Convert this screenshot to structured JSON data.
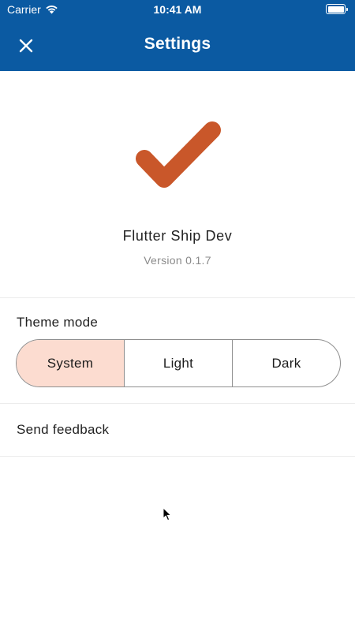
{
  "status_bar": {
    "carrier": "Carrier",
    "time": "10:41 AM",
    "wifi_icon": "wifi-icon",
    "battery_icon": "battery-icon",
    "battery_level": 1.0
  },
  "app_bar": {
    "title": "Settings",
    "close_icon": "close-icon",
    "background_color": "#0b5aa2"
  },
  "about": {
    "logo_icon": "checkmark-icon",
    "logo_color": "#c9572a",
    "app_name": "Flutter Ship Dev",
    "version": "Version 0.1.7"
  },
  "theme": {
    "label": "Theme mode",
    "options": [
      "System",
      "Light",
      "Dark"
    ],
    "selected": "System",
    "selected_color": "#fcdcd0"
  },
  "feedback": {
    "label": "Send feedback"
  }
}
